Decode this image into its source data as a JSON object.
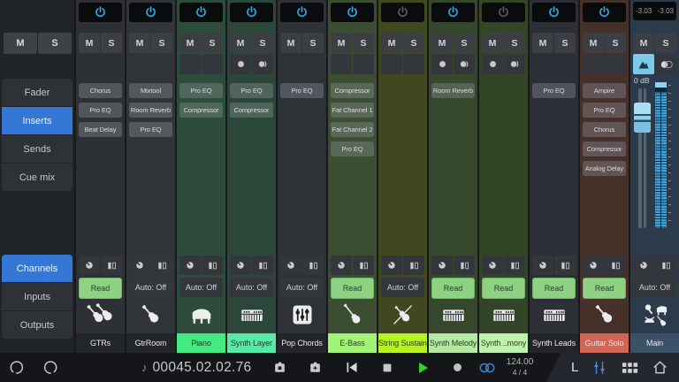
{
  "labels": {
    "mute": "M",
    "solo": "S"
  },
  "sidebar": {
    "view_nav": [
      {
        "label": "Fader",
        "active": false
      },
      {
        "label": "Inserts",
        "active": true
      },
      {
        "label": "Sends",
        "active": false
      },
      {
        "label": "Cue mix",
        "active": false
      }
    ],
    "list_nav": [
      {
        "label": "Channels",
        "active": true
      },
      {
        "label": "Inputs",
        "active": false
      },
      {
        "label": "Outputs",
        "active": false
      }
    ]
  },
  "channels": [
    {
      "name": "GTRs",
      "bg": "#2d3135",
      "name_bg": "#232629",
      "name_color": "#e8e9ea",
      "power": "on",
      "sub": "none",
      "inserts": [
        "Chorus",
        "Pro EQ",
        "Beat Delay"
      ],
      "automation": {
        "label": "Read",
        "active": true
      },
      "icon": "guitars"
    },
    {
      "name": "GtrRoom",
      "bg": "#313539",
      "name_bg": "#232629",
      "name_color": "#e8e9ea",
      "power": "on",
      "sub": "none",
      "inserts": [
        "Mixtool",
        "Room Reverb",
        "Pro EQ"
      ],
      "automation": {
        "label": "Auto: Off",
        "active": false
      },
      "icon": "guitar"
    },
    {
      "name": "Piano",
      "bg": "#2d4c3b",
      "name_bg": "#43e981",
      "name_color": "#1d3a28",
      "power": "on",
      "sub": "blank",
      "inserts": [
        "Pro EQ",
        "Compressor"
      ],
      "automation": {
        "label": "Auto: Off",
        "active": false
      },
      "icon": "piano"
    },
    {
      "name": "Synth Layer",
      "bg": "#2a4739",
      "name_bg": "#57eaa7",
      "name_color": "#1d3a2c",
      "power": "on",
      "sub": "recmon",
      "inserts": [
        "Pro EQ",
        "Compressor"
      ],
      "automation": {
        "label": "Auto: Off",
        "active": false
      },
      "icon": "synth"
    },
    {
      "name": "Pop Chords",
      "bg": "#2e3237",
      "name_bg": "#232629",
      "name_color": "#e8e9ea",
      "power": "on",
      "sub": "none",
      "inserts": [
        "Pro EQ"
      ],
      "automation": {
        "label": "Auto: Off",
        "active": false
      },
      "icon": "sliders"
    },
    {
      "name": "E-Bass",
      "bg": "#3c4e31",
      "name_bg": "#a2f478",
      "name_color": "#2a401c",
      "power": "on",
      "sub": "blank",
      "inserts": [
        "Compressor",
        "Fat Channel 1",
        "Fat Channel 2",
        "Pro EQ"
      ],
      "automation": {
        "label": "Read",
        "active": true
      },
      "icon": "bass"
    },
    {
      "name": "String Sustain",
      "bg": "#40481f",
      "name_bg": "#b6f321",
      "name_color": "#303f0c",
      "power": "off",
      "sub": "blank",
      "inserts": [],
      "automation": {
        "label": "Auto: Off",
        "active": false
      },
      "icon": "violin"
    },
    {
      "name": "Synth Melody",
      "bg": "#35482c",
      "name_bg": "#b4e9a2",
      "name_color": "#27401f",
      "power": "on",
      "sub": "recmon",
      "inserts": [
        "Room Reverb"
      ],
      "automation": {
        "label": "Read",
        "active": true
      },
      "icon": "synth"
    },
    {
      "name": "Synth ..mony",
      "bg": "#334527",
      "name_bg": "#bdf2ae",
      "name_color": "#27401f",
      "power": "off",
      "sub": "recmon",
      "inserts": [],
      "automation": {
        "label": "Read",
        "active": true
      },
      "icon": "synth"
    },
    {
      "name": "Synth Leads",
      "bg": "#2c3036",
      "name_bg": "#232629",
      "name_color": "#e8e9ea",
      "power": "on",
      "sub": "none",
      "inserts": [
        "Pro EQ"
      ],
      "automation": {
        "label": "Read",
        "active": true
      },
      "icon": "synth"
    },
    {
      "name": "Guitar Solo",
      "bg": "#46302a",
      "name_bg": "#d06455",
      "name_color": "#f6e6e2",
      "power": "on",
      "sub": "blank",
      "inserts": [
        "Ampire",
        "Pro EQ",
        "Chorus",
        "Compressor",
        "Analog Delay"
      ],
      "automation": {
        "label": "Read",
        "active": true
      },
      "icon": "guitar"
    },
    {
      "name": "Main",
      "bg": "#2b3b4b",
      "name_bg": "#3a5168",
      "name_color": "#e8eaec",
      "is_main": true,
      "peak_left": "-3.03",
      "peak_right": "-3.03",
      "db_label": "0 dB",
      "sub": "none",
      "inserts": [],
      "automation": {
        "label": "Auto: Off",
        "active": false
      },
      "icon": "multi"
    }
  ],
  "transport": {
    "time": "00045.02.02.76",
    "tempo": "124.00",
    "time_signature": "4 / 4",
    "link_label": "L"
  },
  "colors": {
    "accent_blue": "#3577d4",
    "power_on": "#2ab3f0",
    "power_off": "#5b5f64",
    "read_green": "#8ed183",
    "play_green": "#2fd133",
    "loop_blue": "#3f86d2",
    "meter_blue": "#3f9fd9",
    "fader_cap_blue": "#8ccdef"
  }
}
